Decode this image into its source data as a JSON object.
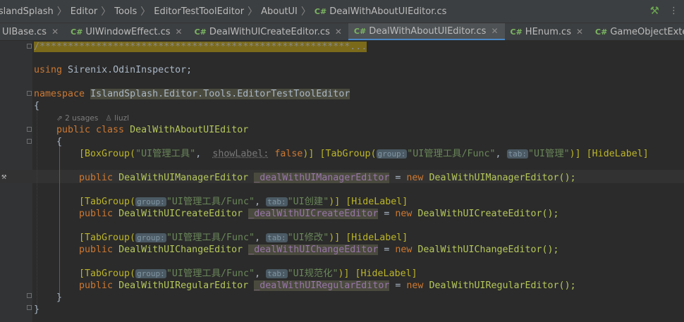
{
  "breadcrumb": [
    "IslandSplash",
    "Editor",
    "Tools",
    "EditorTestToolEditor",
    "AboutUI",
    "DealWithAboutUIEditor.cs"
  ],
  "tabs": [
    {
      "icon": "C#",
      "label": "UIBase.cs",
      "active": false
    },
    {
      "icon": "C#",
      "label": "UIWindowEffect.cs",
      "active": false
    },
    {
      "icon": "C#",
      "label": "DealWithUICreateEditor.cs",
      "active": false
    },
    {
      "icon": "C#",
      "label": "DealWithAboutUIEditor.cs",
      "active": true
    },
    {
      "icon": "C#",
      "label": "HEnum.cs",
      "active": false
    },
    {
      "icon": "C#",
      "label": "GameObjectExtension.cs",
      "active": false
    }
  ],
  "code": {
    "comment_line": "/*******************************************************...",
    "using_kw": "using",
    "using_ns": "Sirenix.OdinInspector;",
    "ns_kw": "namespace",
    "ns_name": "IslandSplash.Editor.Tools.EditorTestToolEditor",
    "brace_open": "{",
    "brace_close": "}",
    "usages": "2 usages",
    "author": "liuzl",
    "class_kw": "public class",
    "class_name": "DealWithAboutUIEditor",
    "manager": {
      "attr1": "[BoxGroup(",
      "str1": "\"UI管理工具\"",
      "p1": "showLabel:",
      "v1": "false",
      "attr2": ")] [TabGroup(",
      "hint_group": "group:",
      "str2": "\"UI管理工具/Func\"",
      "hint_tab": "tab:",
      "str3": "\"UI管理\"",
      "attr3": ")] [HideLabel]",
      "decl": "public",
      "type": "DealWithUIManagerEditor",
      "field": "_dealWithUIManagerEditor",
      "new": "new",
      "ctor": "DealWithUIManagerEditor();"
    },
    "create": {
      "str2": "\"UI管理工具/Func\"",
      "str3": "\"UI创建\"",
      "type": "DealWithUICreateEditor",
      "field": "_dealWithUICreateEditor",
      "ctor": "DealWithUICreateEditor();"
    },
    "change": {
      "str2": "\"UI管理工具/Func\"",
      "str3": "\"UI修改\"",
      "type": "DealWithUIChangeEditor",
      "field": "_dealWithUIChangeEditor",
      "ctor": "DealWithUIChangeEditor();"
    },
    "regular": {
      "str2": "\"UI管理工具/Func\"",
      "str3": "\"UI规范化\"",
      "type": "DealWithUIRegularEditor",
      "field": "_dealWithUIRegularEditor",
      "ctor": "DealWithUIRegularEditor();"
    },
    "tabgroup_open": "[TabGroup(",
    "tabgroup_close": ")] [HideLabel]",
    "kw_public": "public",
    "kw_new": "new",
    "eq": "=",
    "comma": ","
  }
}
